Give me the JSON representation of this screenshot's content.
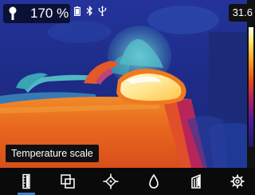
{
  "status": {
    "emissivity_value": "170 %",
    "max_temp": "31.6"
  },
  "tooltip": {
    "label": "Temperature scale"
  },
  "status_icons": [
    "thermometer-probe-icon",
    "battery-icon",
    "bluetooth-icon",
    "usb-icon"
  ],
  "toolbar": {
    "buttons": [
      {
        "name": "temperature-scale-button",
        "icon": "temperature-scale-icon",
        "active": true
      },
      {
        "name": "image-overlay-button",
        "icon": "overlay-squares-icon",
        "active": false
      },
      {
        "name": "measure-spot-button",
        "icon": "crosshair-icon",
        "active": false
      },
      {
        "name": "humidity-button",
        "icon": "drop-icon",
        "active": false
      },
      {
        "name": "color-palette-button",
        "icon": "palette-icon",
        "active": false
      },
      {
        "name": "settings-button",
        "icon": "gear-icon",
        "active": false
      }
    ]
  },
  "colors": {
    "cold": "#1e2d8c",
    "cool": "#3fb6c4",
    "warm": "#e8461c",
    "hot": "#ff9d1f",
    "hottest": "#fff4c2",
    "active_accent": "#3a7bd5"
  }
}
